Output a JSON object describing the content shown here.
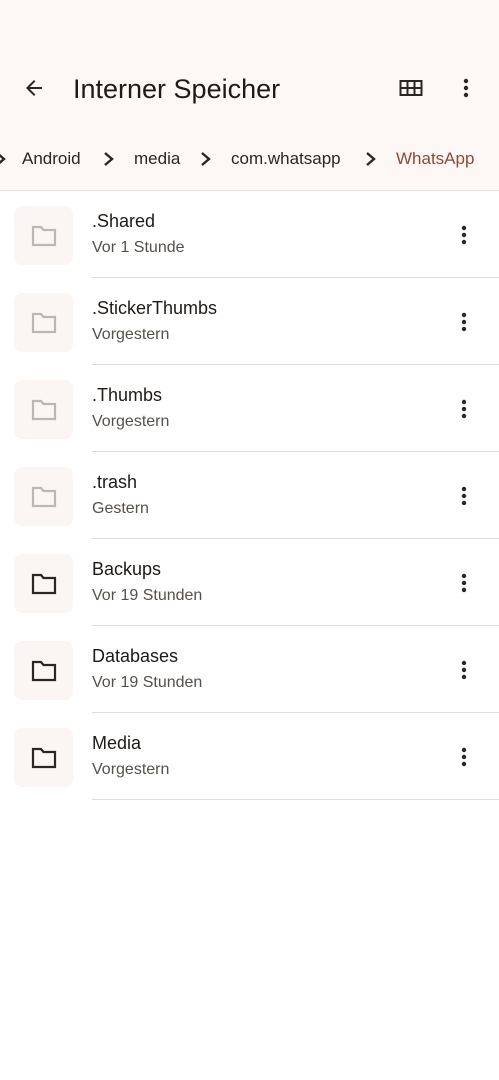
{
  "header": {
    "title": "Interner Speicher",
    "back_icon": "arrow-back-icon",
    "grid_icon": "grid-view-icon",
    "more_icon": "more-vert-icon"
  },
  "breadcrumb": {
    "items": [
      "Android",
      "media",
      "com.whatsapp",
      "WhatsApp"
    ],
    "active_color": "#8b4a37"
  },
  "files": [
    {
      "name": ".Shared",
      "date": "Vor 1 Stunde",
      "hidden": true
    },
    {
      "name": ".StickerThumbs",
      "date": "Vorgestern",
      "hidden": true
    },
    {
      "name": ".Thumbs",
      "date": "Vorgestern",
      "hidden": true
    },
    {
      "name": ".trash",
      "date": "Gestern",
      "hidden": true
    },
    {
      "name": "Backups",
      "date": "Vor 19 Stunden",
      "hidden": false
    },
    {
      "name": "Databases",
      "date": "Vor 19 Stunden",
      "hidden": false
    },
    {
      "name": "Media",
      "date": "Vorgestern",
      "hidden": false
    }
  ],
  "colors": {
    "header_bg": "#fdf8f6",
    "folder_hidden": "#bcb7b3",
    "folder_visible": "#2b2622"
  }
}
